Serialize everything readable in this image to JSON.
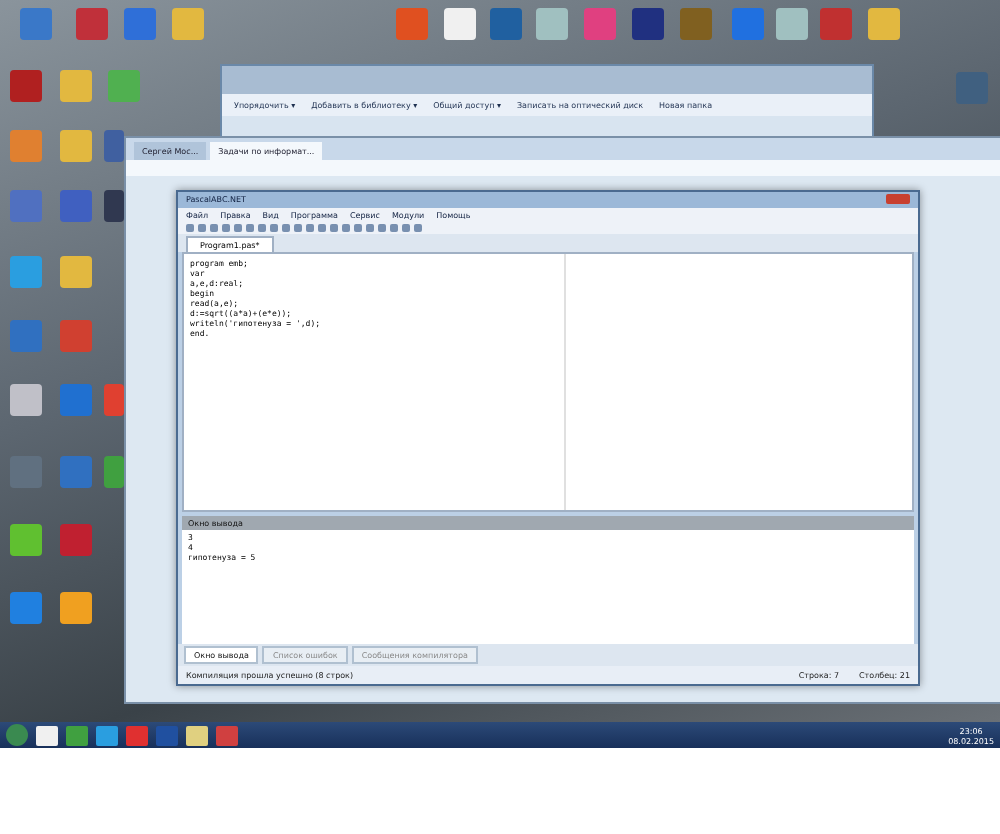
{
  "explorer": {
    "toolbar": [
      "Упорядочить ▾",
      "Добавить в библиотеку ▾",
      "Общий доступ ▾",
      "Записать на оптический диск",
      "Новая папка"
    ]
  },
  "browser": {
    "tabs": [
      {
        "label": "Сергей Мос...",
        "selected": false
      },
      {
        "label": "Задачи по информат...",
        "selected": true
      }
    ]
  },
  "ide": {
    "title": "PascalABC.NET",
    "menu": [
      "Файл",
      "Правка",
      "Вид",
      "Программа",
      "Сервис",
      "Модули",
      "Помощь"
    ],
    "file_tab": "Program1.pas*",
    "code": [
      "program emb;",
      "var",
      "a,e,d:real;",
      "begin",
      "read(a,e);",
      "d:=sqrt((a*a)+(e*e));",
      "writeln('гипотенуза = ',d);",
      "end."
    ],
    "output_title": "Окно вывода",
    "output": [
      "3",
      "4",
      "гипотенуза = 5"
    ],
    "bottom_tabs": [
      {
        "label": "Окно вывода",
        "selected": true
      },
      {
        "label": "Список ошибок",
        "selected": false
      },
      {
        "label": "Сообщения компилятора",
        "selected": false
      }
    ],
    "status": {
      "message": "Компиляция прошла успешно (8 строк)",
      "line": "Строка: 7",
      "column": "Столбец: 21"
    }
  },
  "taskbar": {
    "time": "23:06",
    "date": "08.02.2015"
  }
}
